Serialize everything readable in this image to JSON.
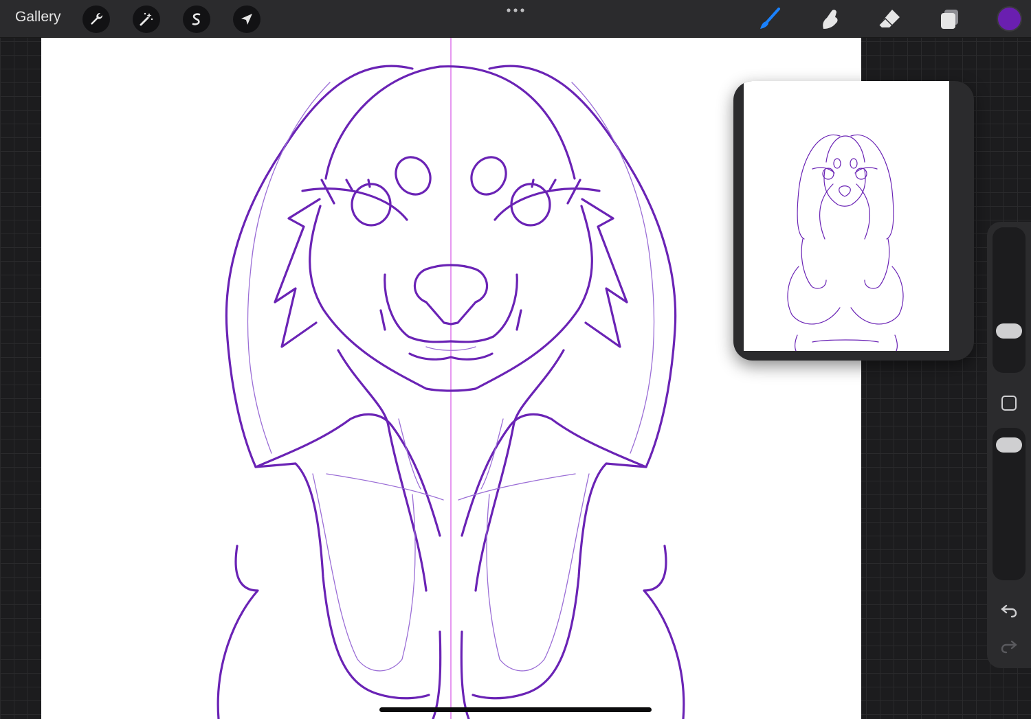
{
  "app": {
    "gallery_label": "Gallery"
  },
  "toolbar": {
    "left_tools": [
      "wrench-icon",
      "magic-wand-icon",
      "selection-icon",
      "transform-arrow-icon"
    ],
    "right_tools": [
      "brush-icon",
      "smudge-icon",
      "eraser-icon",
      "layers-icon"
    ],
    "active_tool": "brush-icon"
  },
  "colors": {
    "accent": "#1a82ff",
    "current_color": "#6a1fb0",
    "stroke": "#6a23b5"
  },
  "sidebar": {
    "brush_size": 0.3,
    "brush_opacity": 0.95
  }
}
